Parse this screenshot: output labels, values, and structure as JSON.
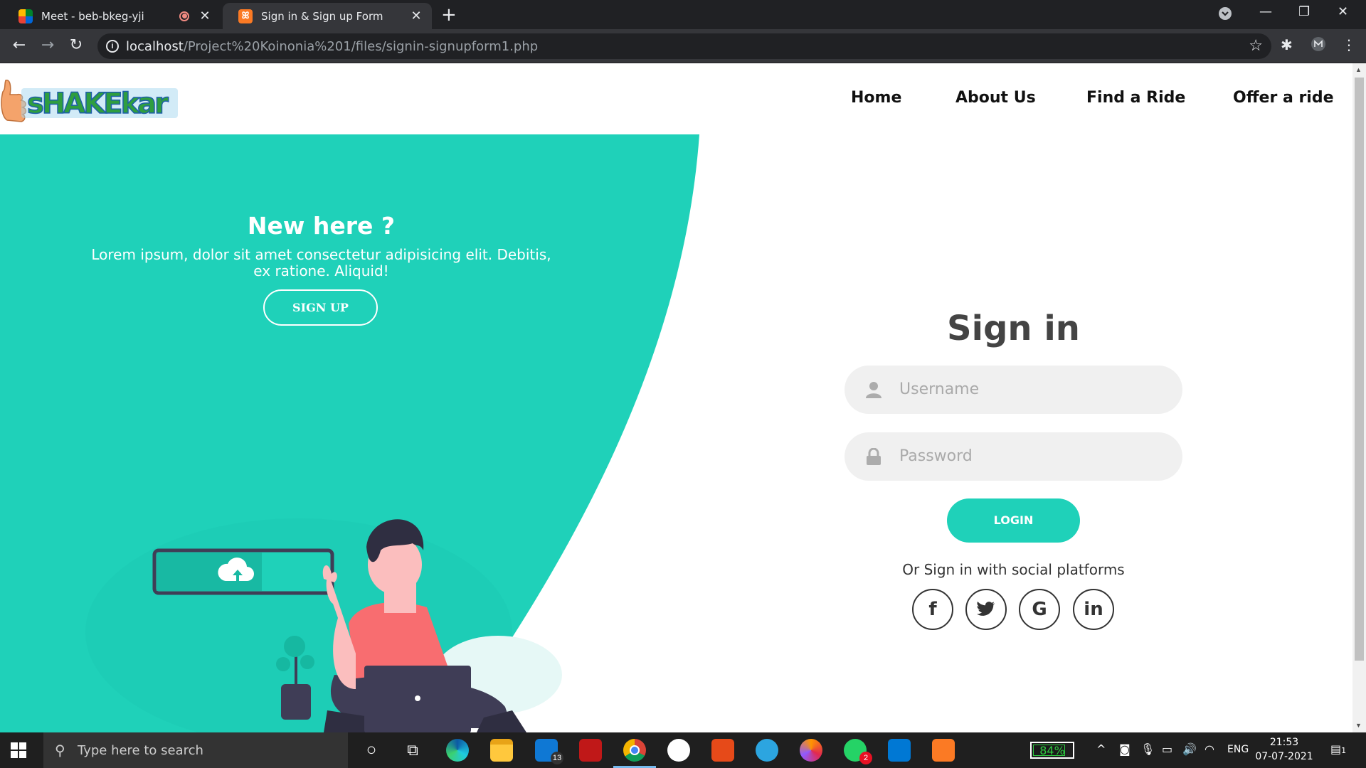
{
  "browser": {
    "tabs": [
      {
        "title": "Meet - beb-bkeg-yji",
        "active": false
      },
      {
        "title": "Sign in & Sign up Form",
        "active": true
      }
    ],
    "url_host": "localhost",
    "url_path": "/Project%20Koinonia%201/files/signin-signupform1.php"
  },
  "page": {
    "logo_alt": "sHAKEkar",
    "nav": [
      "Home",
      "About Us",
      "Find a Ride",
      "Offer a ride"
    ],
    "left_panel": {
      "title": "New here ?",
      "text": "Lorem ipsum, dolor sit amet consectetur adipisicing elit. Debitis, ex ratione. Aliquid!",
      "button": "SIGN UP"
    },
    "signin": {
      "title": "Sign in",
      "username_placeholder": "Username",
      "password_placeholder": "Password",
      "login_button": "LOGIN",
      "social_text": "Or Sign in with social platforms",
      "social": [
        "f",
        "twitter",
        "G",
        "in"
      ]
    },
    "accent_color": "#1fd1b9"
  },
  "taskbar": {
    "search_placeholder": "Type here to search",
    "mail_badge": "13",
    "whatsapp_badge": "2",
    "battery": "84%",
    "battery_level": 0.84,
    "language": "ENG",
    "time": "21:53",
    "date": "07-07-2021",
    "notifications": "1"
  }
}
